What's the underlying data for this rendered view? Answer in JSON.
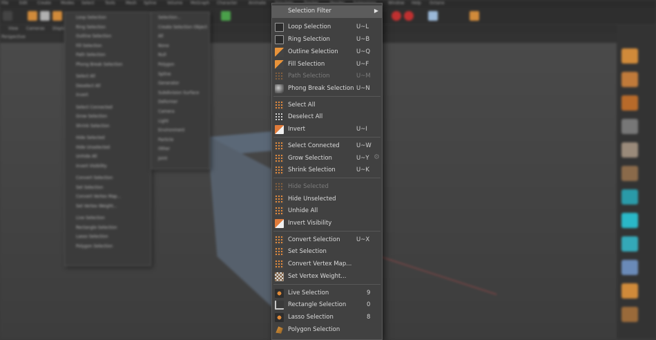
{
  "app": {
    "menubar": [
      "File",
      "Edit",
      "Create",
      "Modes",
      "Select",
      "Tools",
      "Mesh",
      "Spline",
      "Volume",
      "MoGraph",
      "Character",
      "Animate",
      "Simulate",
      "Tracker",
      "Render",
      "Extensions",
      "Window",
      "Help",
      "Octane"
    ],
    "viewport_tabs": [
      "View",
      "Cameras",
      "Display"
    ],
    "viewport_label": "Perspective"
  },
  "selection_filter_menu": {
    "header": "Selection Filter",
    "items": [
      {
        "label": "Selection...",
        "shortcut": ""
      },
      {
        "label": "Create Selection Object",
        "shortcut": ""
      },
      {
        "label": "All",
        "shortcut": ""
      },
      {
        "label": "None",
        "shortcut": ""
      },
      {
        "label": "Null",
        "shortcut": ""
      },
      {
        "label": "Polygon",
        "shortcut": ""
      },
      {
        "label": "Spline",
        "shortcut": ""
      },
      {
        "label": "Generator",
        "shortcut": ""
      },
      {
        "label": "Subdivision Surface",
        "shortcut": ""
      },
      {
        "label": "Deformer",
        "shortcut": ""
      },
      {
        "label": "Camera",
        "shortcut": ""
      },
      {
        "label": "Light",
        "shortcut": ""
      },
      {
        "label": "Environment",
        "shortcut": ""
      },
      {
        "label": "Particle",
        "shortcut": ""
      },
      {
        "label": "Other",
        "shortcut": ""
      },
      {
        "label": "Joint",
        "shortcut": ""
      }
    ]
  },
  "select_menu": {
    "header": "Selection Filter",
    "groups": [
      [
        {
          "label": "Loop Selection",
          "shortcut": "U~L",
          "icon": "loop-selection-icon",
          "disabled": false
        },
        {
          "label": "Ring Selection",
          "shortcut": "U~B",
          "icon": "ring-selection-icon",
          "disabled": false
        },
        {
          "label": "Outline Selection",
          "shortcut": "U~Q",
          "icon": "outline-selection-icon",
          "disabled": false
        },
        {
          "label": "Fill Selection",
          "shortcut": "U~F",
          "icon": "fill-selection-icon",
          "disabled": false
        },
        {
          "label": "Path Selection",
          "shortcut": "U~M",
          "icon": "path-selection-icon",
          "disabled": true
        },
        {
          "label": "Phong Break Selection",
          "shortcut": "U~N",
          "icon": "phong-break-icon",
          "disabled": false
        }
      ],
      [
        {
          "label": "Select All",
          "shortcut": "",
          "icon": "select-all-icon",
          "disabled": false
        },
        {
          "label": "Deselect All",
          "shortcut": "",
          "icon": "deselect-all-icon",
          "disabled": false
        },
        {
          "label": "Invert",
          "shortcut": "U~I",
          "icon": "invert-icon",
          "disabled": false
        }
      ],
      [
        {
          "label": "Select Connected",
          "shortcut": "U~W",
          "icon": "select-connected-icon",
          "disabled": false
        },
        {
          "label": "Grow Selection",
          "shortcut": "U~Y",
          "icon": "grow-selection-icon",
          "disabled": false
        },
        {
          "label": "Shrink Selection",
          "shortcut": "U~K",
          "icon": "shrink-selection-icon",
          "disabled": false
        }
      ],
      [
        {
          "label": "Hide Selected",
          "shortcut": "",
          "icon": "hide-selected-icon",
          "disabled": true
        },
        {
          "label": "Hide Unselected",
          "shortcut": "",
          "icon": "hide-unselected-icon",
          "disabled": false
        },
        {
          "label": "Unhide All",
          "shortcut": "",
          "icon": "unhide-all-icon",
          "disabled": false
        },
        {
          "label": "Invert Visibility",
          "shortcut": "",
          "icon": "invert-visibility-icon",
          "disabled": false
        }
      ],
      [
        {
          "label": "Convert Selection",
          "shortcut": "U~X",
          "icon": "convert-selection-icon",
          "disabled": false
        },
        {
          "label": "Set Selection",
          "shortcut": "",
          "icon": "set-selection-icon",
          "disabled": false
        },
        {
          "label": "Convert Vertex Map...",
          "shortcut": "",
          "icon": "convert-vertex-map-icon",
          "disabled": false
        },
        {
          "label": "Set Vertex Weight...",
          "shortcut": "",
          "icon": "set-vertex-weight-icon",
          "disabled": false
        }
      ],
      [
        {
          "label": "Live Selection",
          "shortcut": "9",
          "icon": "live-selection-icon",
          "disabled": false
        },
        {
          "label": "Rectangle Selection",
          "shortcut": "0",
          "icon": "rectangle-selection-icon",
          "disabled": false
        },
        {
          "label": "Lasso Selection",
          "shortcut": "8",
          "icon": "lasso-selection-icon",
          "disabled": false
        },
        {
          "label": "Polygon Selection",
          "shortcut": "",
          "icon": "polygon-selection-icon",
          "disabled": false
        }
      ]
    ]
  }
}
